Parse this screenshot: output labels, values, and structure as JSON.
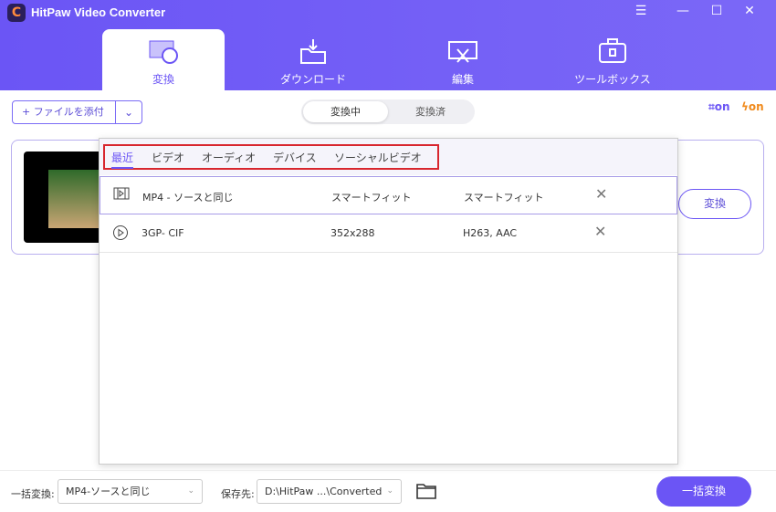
{
  "app": {
    "title": "HitPaw Video Converter",
    "logo": "C"
  },
  "window": {
    "menu": "☰",
    "minimize": "—",
    "maximize": "☐",
    "close": "✕"
  },
  "tabs": [
    {
      "label": "変換",
      "icon": "convert-icon"
    },
    {
      "label": "ダウンロード",
      "icon": "download-icon"
    },
    {
      "label": "編集",
      "icon": "edit-icon"
    },
    {
      "label": "ツールボックス",
      "icon": "toolbox-icon"
    }
  ],
  "toolbar": {
    "add_file": "ファイルを添付",
    "add_plus": "+",
    "dropdown": "⌄",
    "seg_converting": "変換中",
    "seg_converted": "変換済",
    "hw_accel": "on",
    "gpu_on": "on"
  },
  "file_card": {
    "convert_label": "変換"
  },
  "format_popup": {
    "tabs": [
      "最近",
      "ビデオ",
      "オーディオ",
      "デバイス",
      "ソーシャルビデオ"
    ],
    "rows": [
      {
        "name": "MP4 - ソースと同じ",
        "resolution": "スマートフィット",
        "codec": "スマートフィット",
        "icon": "video-film-icon"
      },
      {
        "name": "3GP- CIF",
        "resolution": "352x288",
        "codec": "H263, AAC",
        "icon": "play-circle-icon"
      }
    ],
    "remove": "✕"
  },
  "bottom": {
    "bulk_label": "一括変換:",
    "bulk_format": "MP4-ソースと同じ",
    "save_label": "保存先:",
    "save_path": "D:\\HitPaw ...\\Converted",
    "chevron": "⌄",
    "convert_all": "一括変換"
  },
  "colors": {
    "accent": "#6b55f5",
    "highlight": "#d8262e",
    "orange": "#f08a1c"
  }
}
